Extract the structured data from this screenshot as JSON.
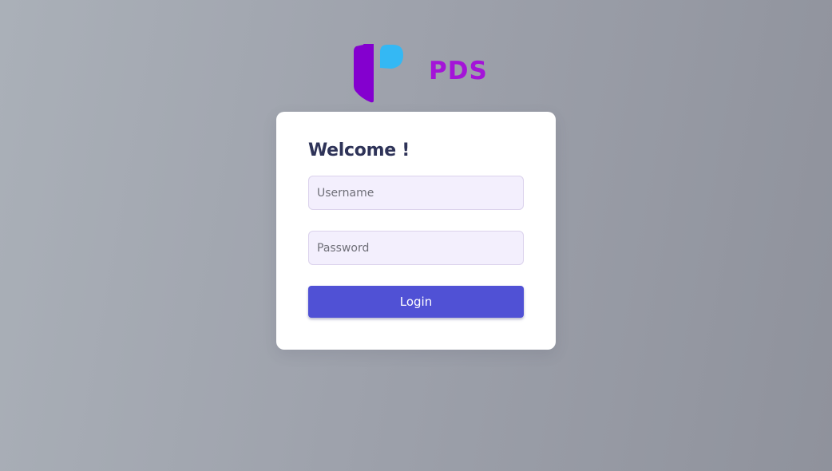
{
  "brand": {
    "name": "PDS",
    "logo_icon": "pds-logo-icon",
    "colors": {
      "wordmark": "#a414d8",
      "mark_primary": "#8400cf",
      "mark_secondary": "#34b8f4"
    }
  },
  "login_card": {
    "title": "Welcome !",
    "username": {
      "placeholder": "Username",
      "value": ""
    },
    "password": {
      "placeholder": "Password",
      "value": ""
    },
    "submit_label": "Login",
    "accent_color": "#5051d5"
  }
}
